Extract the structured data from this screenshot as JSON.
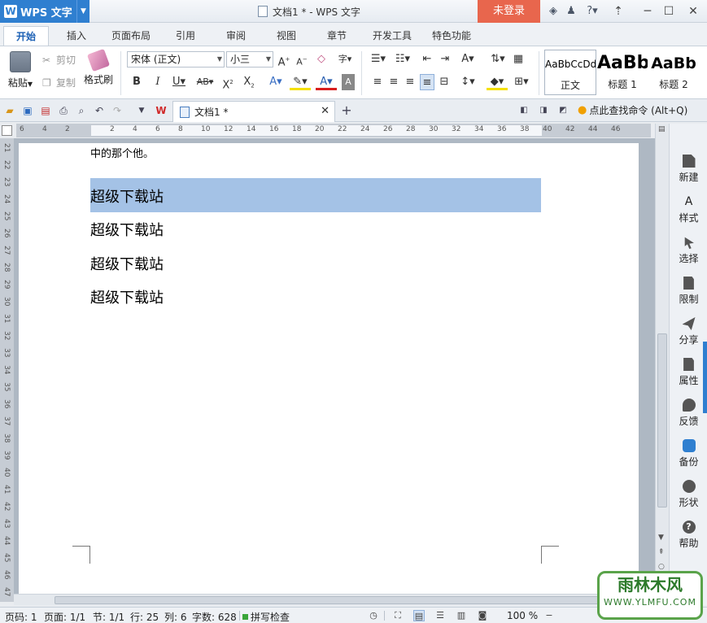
{
  "app": {
    "name": "WPS 文字",
    "logo": "W"
  },
  "window": {
    "title": "文档1 * - WPS 文字",
    "login_label": "未登录"
  },
  "ribbon_tabs": [
    "开始",
    "插入",
    "页面布局",
    "引用",
    "审阅",
    "视图",
    "章节",
    "开发工具",
    "特色功能"
  ],
  "ribbon": {
    "paste_label": "粘贴",
    "cut_label": "剪切",
    "copy_label": "复制",
    "format_painter_label": "格式刷",
    "font_name": "宋体 (正文)",
    "font_size": "小三",
    "styles": [
      {
        "sample": "AaBbCcDd",
        "label": "正文"
      },
      {
        "sample": "AaBb",
        "label": "标题 1"
      },
      {
        "sample": "AaBb",
        "label": "标题 2"
      }
    ]
  },
  "doc_tab": {
    "title": "文档1 *"
  },
  "command_search": "点此查找命令 (Alt+Q)",
  "ruler": {
    "h_labels": [
      "6",
      "4",
      "2",
      "2",
      "4",
      "6",
      "8",
      "10",
      "12",
      "14",
      "16",
      "18",
      "20",
      "22",
      "24",
      "26",
      "28",
      "30",
      "32",
      "34",
      "36",
      "38",
      "40",
      "42",
      "44",
      "46"
    ],
    "v_labels": [
      "21",
      "22",
      "23",
      "24",
      "25",
      "26",
      "27",
      "28",
      "29",
      "30",
      "31",
      "32",
      "33",
      "34",
      "35",
      "36",
      "37",
      "38",
      "39",
      "40",
      "41",
      "42",
      "43",
      "44",
      "45",
      "46",
      "47"
    ]
  },
  "document": {
    "top_line": "中的那个他。",
    "paragraphs": [
      "超级下载站",
      "超级下载站",
      "超级下载站",
      "超级下载站"
    ],
    "selected_index": 0
  },
  "sidebar": [
    "新建",
    "样式",
    "选择",
    "限制",
    "分享",
    "属性",
    "反馈",
    "备份",
    "形状",
    "帮助"
  ],
  "status": {
    "page_no": "页码: 1",
    "page_count": "页面: 1/1",
    "section": "节: 1/1",
    "row": "行: 25",
    "column": "列: 6",
    "word_count": "字数: 628",
    "spell_check": "拼写检查",
    "zoom": "100 %"
  },
  "watermark": {
    "line1": "雨林木风",
    "line2": "WWW.YLMFU.COM"
  },
  "colors": {
    "accent": "#2f7fd0",
    "login": "#e8664d",
    "selection": "#a4c2e6"
  }
}
